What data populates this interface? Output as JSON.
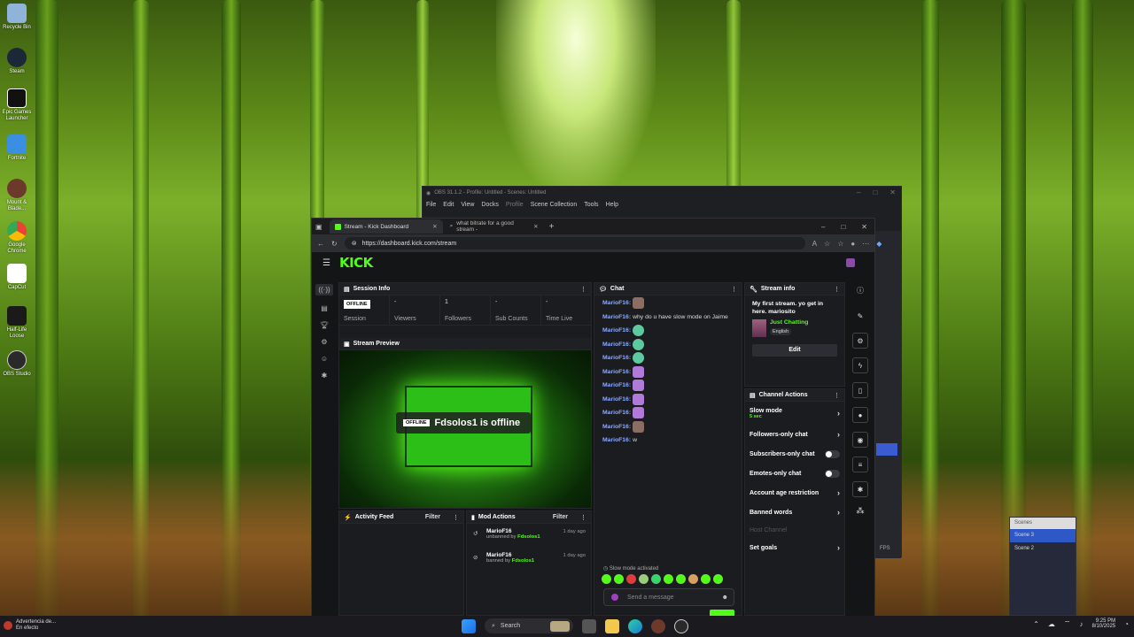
{
  "desktop": {
    "icons": [
      {
        "label": "Recycle Bin"
      },
      {
        "label": "Steam"
      },
      {
        "label": "Epic Games Launcher"
      },
      {
        "label": "Fortnite"
      },
      {
        "label": "Mount & Blade..."
      },
      {
        "label": "Google Chrome"
      },
      {
        "label": "CapCut"
      },
      {
        "label": "Half-Life Loose"
      },
      {
        "label": "OBS Studio"
      }
    ]
  },
  "obs": {
    "title": "OBS 31.1.2 - Profile: Untitled - Scenes: Untitled",
    "menu": [
      "File",
      "Edit",
      "View",
      "Docks",
      "Profile",
      "Scene Collection",
      "Tools",
      "Help"
    ],
    "fps_label": "FPS"
  },
  "browser": {
    "tabs": [
      {
        "title": "Stream - Kick Dashboard"
      },
      {
        "title": "what bitrate for a good stream -"
      }
    ],
    "url": "https://dashboard.kick.com/stream"
  },
  "kick": {
    "logo": "KICK",
    "session": {
      "title": "Session Info",
      "badge": "OFFLINE",
      "stats": [
        {
          "value": "",
          "label": "Session"
        },
        {
          "value": "-",
          "label": "Viewers"
        },
        {
          "value": "1",
          "label": "Followers"
        },
        {
          "value": "-",
          "label": "Sub Counts"
        },
        {
          "value": "-",
          "label": "Time Live"
        }
      ]
    },
    "preview": {
      "title": "Stream Preview",
      "badge": "OFFLINE",
      "message": "Fdsolos1 is offline"
    },
    "activity": {
      "title": "Activity Feed",
      "filter": "Filter"
    },
    "mod_actions": {
      "title": "Mod Actions",
      "filter": "Filter",
      "items": [
        {
          "user": "MarioF16",
          "action": "unbanned by",
          "by": "Fdsolos1",
          "time": "1 day ago"
        },
        {
          "user": "MarioF16",
          "action": "banned by",
          "by": "Fdsolos1",
          "time": "1 day ago"
        }
      ]
    },
    "chat": {
      "title": "Chat",
      "messages": [
        {
          "user": "MarioF16:",
          "text": ""
        },
        {
          "user": "MarioF16:",
          "text": "why do u have slow mode on Jaime"
        },
        {
          "user": "MarioF16:",
          "text": ""
        },
        {
          "user": "MarioF16:",
          "text": ""
        },
        {
          "user": "MarioF16:",
          "text": ""
        },
        {
          "user": "MarioF16:",
          "text": ""
        },
        {
          "user": "MarioF16:",
          "text": ""
        },
        {
          "user": "MarioF16:",
          "text": ""
        },
        {
          "user": "MarioF16:",
          "text": ""
        },
        {
          "user": "MarioF16:",
          "text": ""
        },
        {
          "user": "MarioF16:",
          "text": "w"
        }
      ],
      "status": "Slow mode activated",
      "placeholder": "Send a message"
    },
    "stream_info": {
      "title": "Stream info",
      "stream_title": "My first stream. yo get in here. mariosito",
      "category": "Just Chatting",
      "language": "English",
      "edit": "Edit"
    },
    "channel_actions": {
      "title": "Channel Actions",
      "items": [
        {
          "label": "Slow mode",
          "sub": "5 sec"
        },
        {
          "label": "Followers-only chat"
        },
        {
          "label": "Subscribers-only chat"
        },
        {
          "label": "Emotes-only chat"
        },
        {
          "label": "Account age restriction"
        },
        {
          "label": "Banned words"
        },
        {
          "label": "Host Channel"
        },
        {
          "label": "Set goals"
        }
      ]
    }
  },
  "scenes_popup": {
    "header": "Scenes",
    "items": [
      "Scene 3",
      "Scene 2"
    ]
  },
  "taskbar": {
    "notification_line1": "Advertencia de...",
    "notification_line2": "En efecto",
    "search": "Search",
    "time": "9:25 PM",
    "date": "8/10/2025"
  },
  "colors": {
    "kick_green": "#53fc18",
    "username_blue": "#8aa9ff"
  }
}
